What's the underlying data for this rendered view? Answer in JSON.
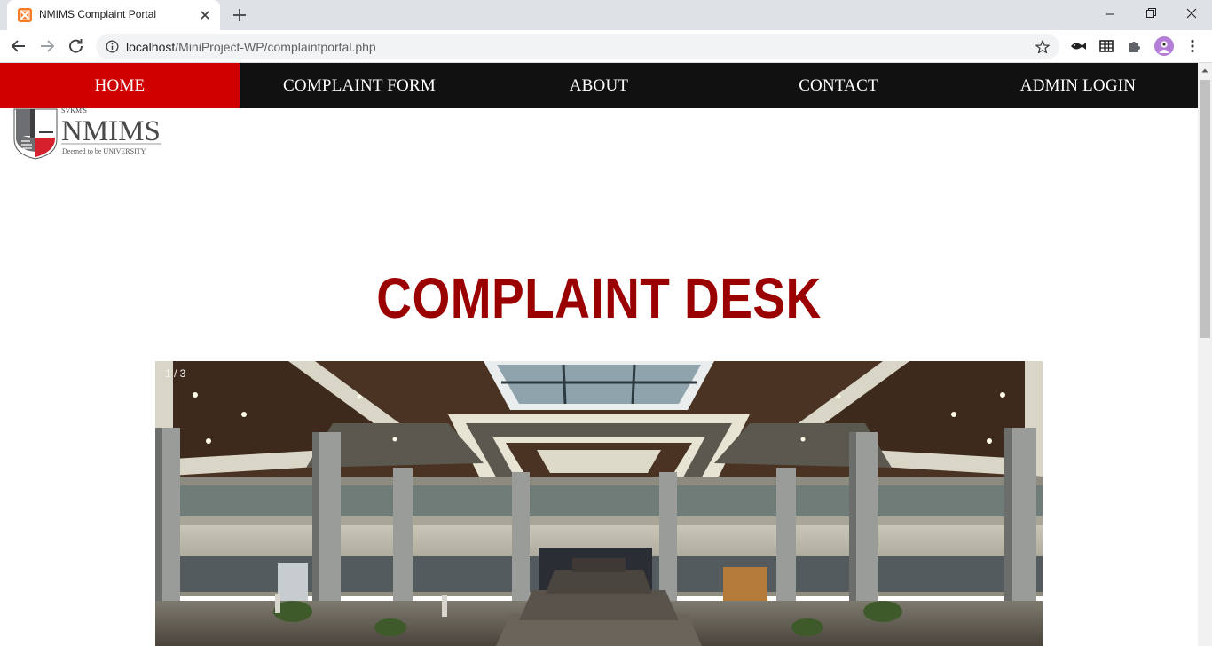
{
  "browser": {
    "tab_title": "NMIMS Complaint Portal",
    "url_host": "localhost",
    "url_path": "/MiniProject-WP/complaintportal.php"
  },
  "nav": {
    "items": [
      {
        "label": "HOME",
        "active": true
      },
      {
        "label": "COMPLAINT FORM",
        "active": false
      },
      {
        "label": "ABOUT",
        "active": false
      },
      {
        "label": "CONTACT",
        "active": false
      },
      {
        "label": "ADMIN LOGIN",
        "active": false
      }
    ],
    "active_color": "#d00000",
    "bar_color": "#111111"
  },
  "logo": {
    "prefix": "SVKM'S",
    "name": "NMIMS",
    "tagline": "Deemed to be UNIVERSITY"
  },
  "headline": {
    "text": "COMPLAINT DESK",
    "color": "#9b0000"
  },
  "slideshow": {
    "counter": "1 / 3",
    "image": "university-atrium-photo"
  }
}
